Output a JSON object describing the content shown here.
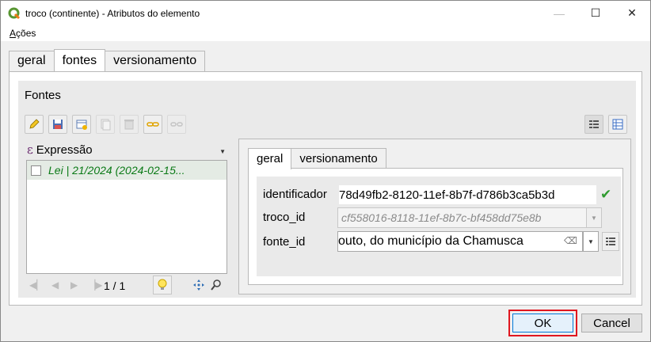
{
  "window": {
    "title": "troco (continente) - Atributos do elemento",
    "controls": {
      "minimize": "—",
      "maximize": "☐",
      "close": "✕"
    }
  },
  "menubar": {
    "actions_label_underlined": "A",
    "actions_label_rest": "ções"
  },
  "outer_tabs": [
    {
      "label": "geral",
      "active": false
    },
    {
      "label": "fontes",
      "active": true
    },
    {
      "label": "versionamento",
      "active": false
    }
  ],
  "fontes": {
    "group_title": "Fontes",
    "expression_label": "Expressão",
    "list_items": [
      {
        "label": "Lei | 21/2024 (2024-02-15...",
        "checked": false
      }
    ],
    "pager": {
      "page": "1 / 1"
    }
  },
  "inner_tabs": [
    {
      "label": "geral",
      "active": true
    },
    {
      "label": "versionamento",
      "active": false
    }
  ],
  "form": {
    "identificador": {
      "label": "identificador",
      "value": "78d49fb2-8120-11ef-8b7f-d786b3ca5b3d"
    },
    "troco_id": {
      "label": "troco_id",
      "value": "cf558016-8118-11ef-8b7c-bf458dd75e8b"
    },
    "fonte_id": {
      "label": "fonte_id",
      "value": "outo, do município da Chamusca"
    }
  },
  "buttons": {
    "ok": "OK",
    "cancel": "Cancel"
  },
  "colors": {
    "accent": "#0078d7",
    "highlight": "#e0161f",
    "list_text": "#0b7a17",
    "valid": "#2f9b2f"
  }
}
